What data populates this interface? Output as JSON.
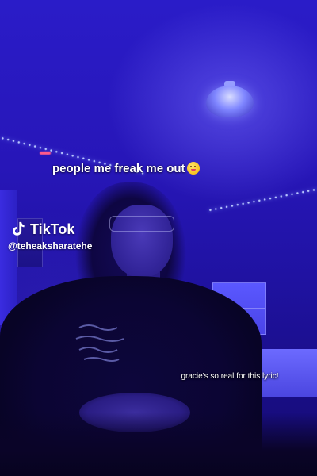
{
  "caption": {
    "text": "people me freak me out",
    "emoji": "winking-tongue-face"
  },
  "watermark": {
    "brand": "TikTok",
    "handle": "@teheaksharatehe"
  },
  "sub_caption": {
    "text": "gracie's so real for this lyric!"
  },
  "colors": {
    "room_blue": "#2a1cc8",
    "led": "#b8c6ff",
    "text": "#ffffff"
  }
}
